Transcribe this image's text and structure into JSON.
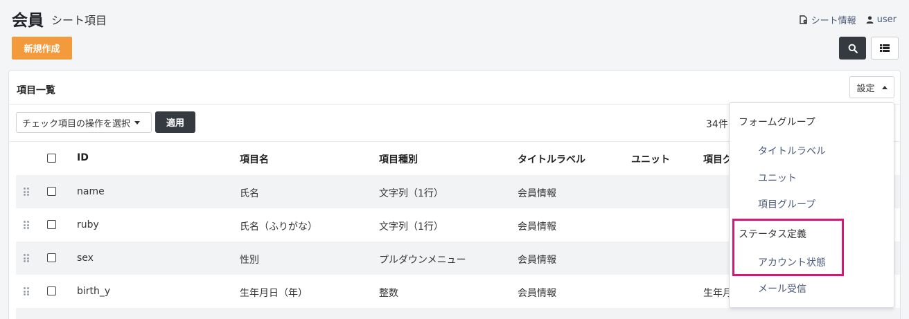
{
  "header": {
    "title": "会員",
    "subtitle": "シート項目",
    "links": [
      {
        "icon": "document-info-icon",
        "label": "シート情報"
      },
      {
        "icon": "user-icon",
        "label": "user"
      }
    ]
  },
  "toolbar": {
    "new_label": "新規作成",
    "search_icon": "search-icon",
    "list_icon": "list-icon"
  },
  "card": {
    "title": "項目一覧",
    "settings_label": "設定",
    "bulk_action_placeholder": "チェック項目の操作を選択",
    "apply_label": "適用",
    "count_text": "34件"
  },
  "table": {
    "columns": [
      "ID",
      "項目名",
      "項目種別",
      "タイトルラベル",
      "ユニット",
      "項目グ"
    ],
    "rows": [
      {
        "id": "name",
        "name": "氏名",
        "type": "文字列（1行）",
        "title_label": "会員情報",
        "unit": "",
        "group": ""
      },
      {
        "id": "ruby",
        "name": "氏名（ふりがな）",
        "type": "文字列（1行）",
        "title_label": "会員情報",
        "unit": "",
        "group": ""
      },
      {
        "id": "sex",
        "name": "性別",
        "type": "プルダウンメニュー",
        "title_label": "会員情報",
        "unit": "",
        "group": ""
      },
      {
        "id": "birth_y",
        "name": "生年月日（年）",
        "type": "整数",
        "title_label": "会員情報",
        "unit": "",
        "group": "生年月"
      }
    ]
  },
  "settings_menu": {
    "sections": [
      {
        "heading": "フォームグループ",
        "items": [
          "タイトルラベル",
          "ユニット",
          "項目グループ"
        ]
      },
      {
        "heading": "ステータス定義",
        "items": [
          "アカウント状態",
          "メール受信"
        ]
      }
    ]
  },
  "colors": {
    "primary_orange": "#f39a3c",
    "dark_button": "#343a40",
    "link_blue": "#4a5a78",
    "highlight_magenta": "#d3187a"
  }
}
